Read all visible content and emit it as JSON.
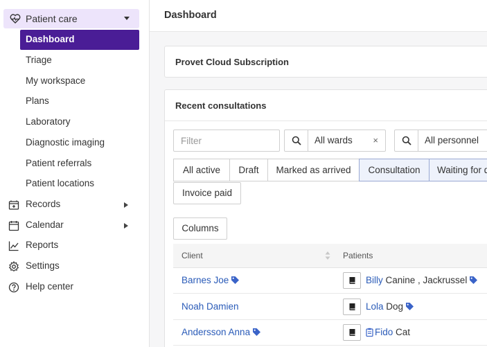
{
  "sidebar": {
    "group": {
      "label": "Patient care",
      "icon": "heart-pulse-icon"
    },
    "sub_items": [
      "Dashboard",
      "Triage",
      "My workspace",
      "Plans",
      "Laboratory",
      "Diagnostic imaging",
      "Patient referrals",
      "Patient locations"
    ],
    "active_sub": "Dashboard",
    "main_items": [
      {
        "label": "Records",
        "icon": "records-icon",
        "expandable": true
      },
      {
        "label": "Calendar",
        "icon": "calendar-icon",
        "expandable": true
      },
      {
        "label": "Reports",
        "icon": "chart-line-icon",
        "expandable": false
      },
      {
        "label": "Settings",
        "icon": "gear-icon",
        "expandable": false
      },
      {
        "label": "Help center",
        "icon": "help-icon",
        "expandable": false
      }
    ]
  },
  "header": {
    "title": "Dashboard"
  },
  "subscription_card": {
    "title": "Provet Cloud Subscription"
  },
  "consultations": {
    "title": "Recent consultations",
    "filter_placeholder": "Filter",
    "wards_select": "All wards",
    "personnel_select": "All personnel",
    "clear_symbol": "×",
    "tabs": [
      "All active",
      "Draft",
      "Marked as arrived",
      "Consultation",
      "Waiting for discharge"
    ],
    "active_tabs": [
      "Consultation",
      "Waiting for discharge"
    ],
    "extra_tab": "Invoice paid",
    "columns_button": "Columns",
    "table": {
      "headers": [
        "Client",
        "Patients"
      ],
      "rows": [
        {
          "client": "Barnes Joe",
          "client_tag": true,
          "patient": "Billy",
          "patient_detail": " Canine , Jackrussel",
          "patient_tag": true,
          "clipboard": false
        },
        {
          "client": "Noah Damien",
          "client_tag": false,
          "patient": "Lola",
          "patient_detail": " Dog",
          "patient_tag": true,
          "clipboard": false
        },
        {
          "client": "Andersson Anna",
          "client_tag": true,
          "patient": "Fido",
          "patient_detail": " Cat",
          "patient_tag": false,
          "clipboard": true
        }
      ]
    }
  },
  "colors": {
    "active_nav": "#4a1d96",
    "group_bg": "#ede4fb",
    "link": "#2a5bb8",
    "tag": "#3a63c8"
  }
}
